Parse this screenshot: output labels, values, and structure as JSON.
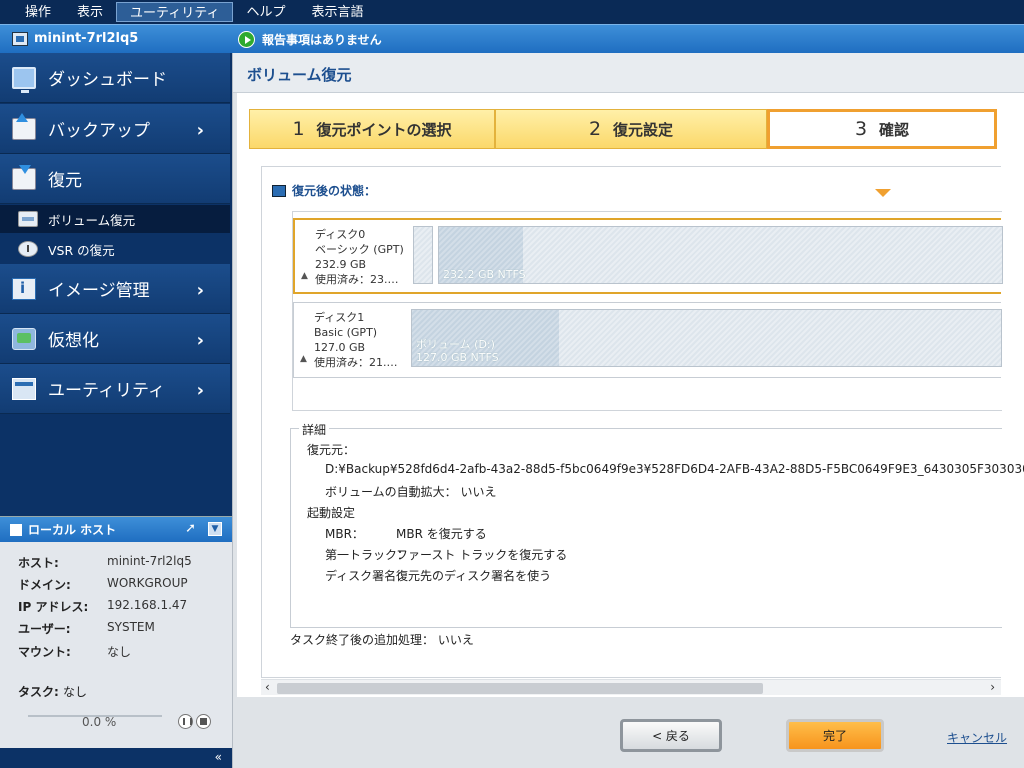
{
  "menu": [
    "操作",
    "表示",
    "ユーティリティ",
    "ヘルプ",
    "表示言語"
  ],
  "menu_active_index": 2,
  "statusbar": {
    "hostname": "minint-7rl2lq5",
    "report": "報告事項はありません"
  },
  "sidebar": {
    "items": [
      {
        "label": "ダッシュボード",
        "icon": "monitor-icon"
      },
      {
        "label": "バックアップ",
        "icon": "backup-icon"
      },
      {
        "label": "復元",
        "icon": "restore-icon"
      },
      {
        "label": "イメージ管理",
        "icon": "image-management-icon"
      },
      {
        "label": "仮想化",
        "icon": "virtualization-icon"
      },
      {
        "label": "ユーティリティ",
        "icon": "utility-icon"
      }
    ],
    "subitems": [
      {
        "label": "ボリューム復元",
        "icon": "volume-restore-icon",
        "active": true
      },
      {
        "label": "VSR の復元",
        "icon": "vsr-restore-icon",
        "active": false
      }
    ]
  },
  "local_host": {
    "title": "ローカル ホスト",
    "rows": [
      {
        "key": "ホスト:",
        "value": "minint-7rl2lq5"
      },
      {
        "key": "ドメイン:",
        "value": "WORKGROUP"
      },
      {
        "key": "IP アドレス:",
        "value": "192.168.1.47"
      },
      {
        "key": "ユーザー:",
        "value": "SYSTEM"
      },
      {
        "key": "マウント:",
        "value": "なし"
      }
    ],
    "task_label": "タスク:",
    "task_value": "なし",
    "progress_text": "0.0 %",
    "progress": 0,
    "collapse_glyph": "«"
  },
  "page": {
    "title": "ボリューム復元"
  },
  "steps": [
    {
      "num": "1",
      "label": "復元ポイントの選択"
    },
    {
      "num": "2",
      "label": "復元設定"
    },
    {
      "num": "3",
      "label": "確認",
      "active": true
    }
  ],
  "state": {
    "title": "復元後の状態：",
    "disks": [
      {
        "name": "ディスク0",
        "type": "ベーシック (GPT)",
        "size": "232.9 GB",
        "used": "使用済み：23.…",
        "selected": true,
        "partitions": [
          {
            "label": "",
            "used_fraction": 0
          },
          {
            "label": "232.2 GB NTFS",
            "used_fraction": 0.15
          }
        ]
      },
      {
        "name": "ディスク1",
        "type": "Basic (GPT)",
        "size": "127.0 GB",
        "used": "使用済み：21.…",
        "selected": false,
        "partitions": [
          {
            "label": "ボリューム (D:)\n127.0 GB NTFS",
            "used_fraction": 0.25
          }
        ]
      }
    ]
  },
  "details": {
    "legend": "詳細",
    "source_label": "復元元：",
    "source_path": "D:¥Backup¥528fd6d4-2afb-43a2-88d5-f5bc0649f9e3¥528FD6D4-2AFB-43A2-88D5-F5BC0649F9E3_6430305F3030303",
    "auto_expand": "ボリュームの自動拡大：  いいえ",
    "boot_settings": "起動設定",
    "mbr_key": "MBR：",
    "mbr_value": "MBR を復元する",
    "track_key": "第一トラック：",
    "track_value": "ファースト トラックを復元する",
    "sig_key": "ディスク署名：",
    "sig_value": "復元先のディスク署名を使う",
    "post_task": "タスク終了後の追加処理：  いいえ"
  },
  "footer": {
    "back": "< 戻る",
    "finish": "完了",
    "cancel": "キャンセル"
  },
  "colors": {
    "menubar": "#0a2a56",
    "accent_orange": "#f7941d",
    "step_yellow": "#fbd86a",
    "title_blue": "#1d4f8f"
  }
}
